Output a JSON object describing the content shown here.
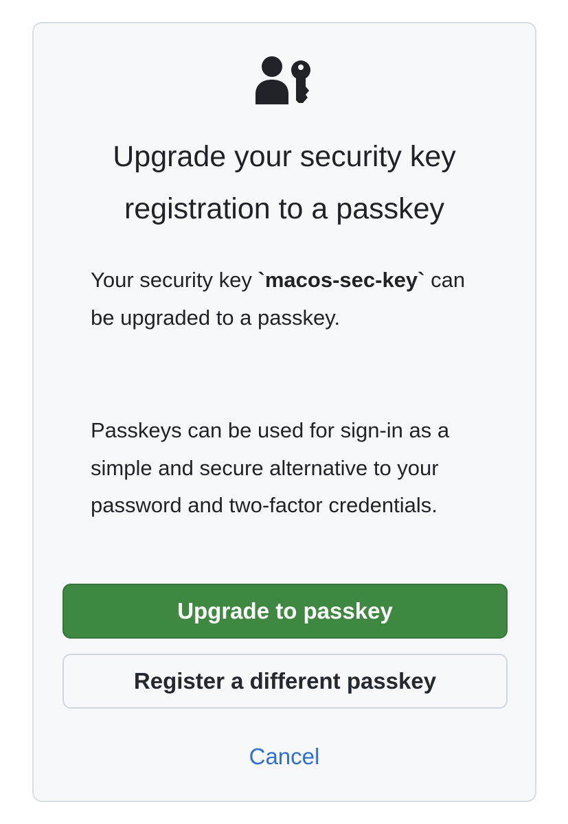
{
  "dialog": {
    "icon": "person-key-icon",
    "title": "Upgrade your security key registration to a passkey",
    "message_prefix": "Your security key ",
    "key_name": "`macos-sec-key`",
    "message_suffix": " can be upgraded to a passkey.",
    "description": "Passkeys can be used for sign-in as a simple and secure alternative to your password and two-factor credentials.",
    "primary_button_label": "Upgrade to passkey",
    "secondary_button_label": "Register a different passkey",
    "cancel_label": "Cancel"
  },
  "colors": {
    "card_background": "#f6f8fa",
    "primary_button": "#3f8841",
    "link": "#2f6fd6",
    "text": "#1f2328"
  }
}
